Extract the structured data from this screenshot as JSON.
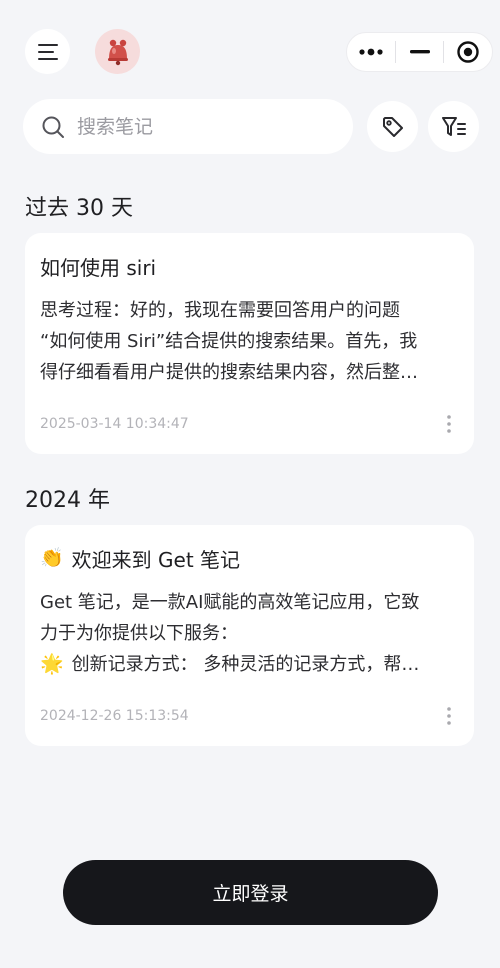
{
  "header": {
    "menu_icon": "hamburger-menu-icon",
    "avatar_icon": "bell-mascot-icon",
    "capsule": {
      "more_icon": "more-dots-icon",
      "minimize_icon": "minimize-icon",
      "close_icon": "target-close-icon"
    }
  },
  "search": {
    "placeholder": "搜索笔记",
    "value": ""
  },
  "filters": {
    "tag_icon": "tag-icon",
    "filter_icon": "filter-list-icon"
  },
  "sections": [
    {
      "title": "过去 30 天",
      "notes": [
        {
          "title": "如何使用 siri",
          "body_lines": [
            "思考过程：好的，我现在需要回答用户的问题",
            "“如何使用 Siri”结合提供的搜索结果。首先，我",
            "得仔细看看用户提供的搜索结果内容，然后整…"
          ],
          "date": "2025-03-14 10:34:47"
        }
      ]
    },
    {
      "title": "2024 年",
      "notes": [
        {
          "title_emoji": "👏",
          "title": "欢迎来到 Get 笔记",
          "body_lines": [
            "Get 笔记，是一款AI赋能的高效笔记应用，它致",
            "力于为你提供以下服务："
          ],
          "body_line3_emoji": "🌟",
          "body_line3": "创新记录方式： 多种灵活的记录方式，帮…",
          "date": "2024-12-26 15:13:54"
        }
      ]
    }
  ],
  "login": {
    "label": "立即登录"
  },
  "colors": {
    "background": "#f4f5f8",
    "card": "#ffffff",
    "button_dark": "#16171b",
    "muted_text": "#b3b3b8"
  }
}
